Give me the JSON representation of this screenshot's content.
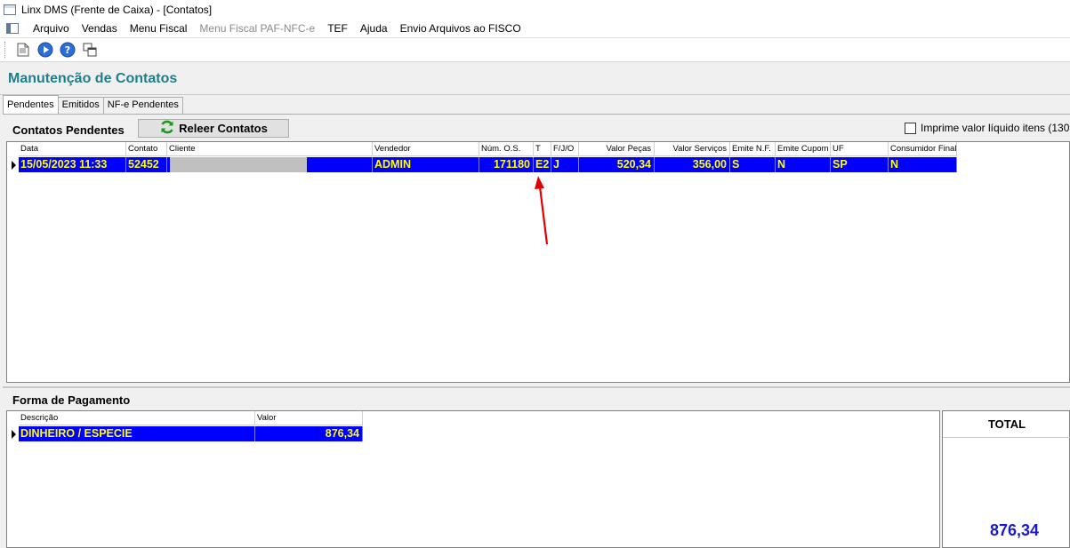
{
  "window": {
    "title": "Linx DMS (Frente de Caixa) - [Contatos]"
  },
  "menu": [
    "Arquivo",
    "Vendas",
    "Menu Fiscal",
    "Menu Fiscal PAF-NFC-e",
    "TEF",
    "Ajuda",
    "Envio Arquivos ao FISCO"
  ],
  "header": {
    "title": "Manutenção de Contatos"
  },
  "tabs": [
    "Pendentes",
    "Emitidos",
    "NF-e Pendentes"
  ],
  "contatos": {
    "title": "Contatos Pendentes",
    "reload_label": "Releer Contatos",
    "print_option": "Imprime valor líquido itens (130",
    "columns": [
      "Data",
      "Contato",
      "Cliente",
      "Vendedor",
      "Núm. O.S.",
      "T",
      "F/J/O",
      "Valor Peças",
      "Valor Serviços",
      "Emite N.F.",
      "Emite Cupom",
      "UF",
      "Consumidor Final"
    ],
    "rows": [
      {
        "data": "15/05/2023 11:33",
        "contato": "52452",
        "cliente": "",
        "vendedor": "ADMIN",
        "os": "171180",
        "t": "E2",
        "fjo": "J",
        "pecas": "520,34",
        "servicos": "356,00",
        "nf": "S",
        "cupom": "N",
        "uf": "SP",
        "consumidor": "N"
      }
    ]
  },
  "pagamento": {
    "title": "Forma de Pagamento",
    "columns": [
      "Descrição",
      "Valor"
    ],
    "rows": [
      {
        "descricao": "DINHEIRO / ESPECIE",
        "valor": "876,34"
      }
    ]
  },
  "total": {
    "label": "TOTAL",
    "value": "876,34"
  },
  "colors": {
    "selection": "#0000ff",
    "selection_text": "#ffff00",
    "title_teal": "#1e7f8c",
    "total_blue": "#1a1acc",
    "arrow": "#e00000"
  }
}
